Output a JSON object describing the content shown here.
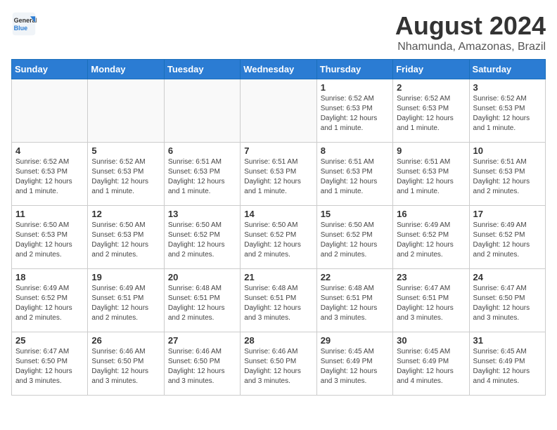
{
  "header": {
    "logo_line1": "General",
    "logo_line2": "Blue",
    "main_title": "August 2024",
    "subtitle": "Nhamunda, Amazonas, Brazil"
  },
  "weekdays": [
    "Sunday",
    "Monday",
    "Tuesday",
    "Wednesday",
    "Thursday",
    "Friday",
    "Saturday"
  ],
  "weeks": [
    [
      {
        "day": "",
        "empty": true
      },
      {
        "day": "",
        "empty": true
      },
      {
        "day": "",
        "empty": true
      },
      {
        "day": "",
        "empty": true
      },
      {
        "day": "1",
        "sunrise": "6:52 AM",
        "sunset": "6:53 PM",
        "daylight": "12 hours and 1 minute."
      },
      {
        "day": "2",
        "sunrise": "6:52 AM",
        "sunset": "6:53 PM",
        "daylight": "12 hours and 1 minute."
      },
      {
        "day": "3",
        "sunrise": "6:52 AM",
        "sunset": "6:53 PM",
        "daylight": "12 hours and 1 minute."
      }
    ],
    [
      {
        "day": "4",
        "sunrise": "6:52 AM",
        "sunset": "6:53 PM",
        "daylight": "12 hours and 1 minute."
      },
      {
        "day": "5",
        "sunrise": "6:52 AM",
        "sunset": "6:53 PM",
        "daylight": "12 hours and 1 minute."
      },
      {
        "day": "6",
        "sunrise": "6:51 AM",
        "sunset": "6:53 PM",
        "daylight": "12 hours and 1 minute."
      },
      {
        "day": "7",
        "sunrise": "6:51 AM",
        "sunset": "6:53 PM",
        "daylight": "12 hours and 1 minute."
      },
      {
        "day": "8",
        "sunrise": "6:51 AM",
        "sunset": "6:53 PM",
        "daylight": "12 hours and 1 minute."
      },
      {
        "day": "9",
        "sunrise": "6:51 AM",
        "sunset": "6:53 PM",
        "daylight": "12 hours and 1 minute."
      },
      {
        "day": "10",
        "sunrise": "6:51 AM",
        "sunset": "6:53 PM",
        "daylight": "12 hours and 2 minutes."
      }
    ],
    [
      {
        "day": "11",
        "sunrise": "6:50 AM",
        "sunset": "6:53 PM",
        "daylight": "12 hours and 2 minutes."
      },
      {
        "day": "12",
        "sunrise": "6:50 AM",
        "sunset": "6:53 PM",
        "daylight": "12 hours and 2 minutes."
      },
      {
        "day": "13",
        "sunrise": "6:50 AM",
        "sunset": "6:52 PM",
        "daylight": "12 hours and 2 minutes."
      },
      {
        "day": "14",
        "sunrise": "6:50 AM",
        "sunset": "6:52 PM",
        "daylight": "12 hours and 2 minutes."
      },
      {
        "day": "15",
        "sunrise": "6:50 AM",
        "sunset": "6:52 PM",
        "daylight": "12 hours and 2 minutes."
      },
      {
        "day": "16",
        "sunrise": "6:49 AM",
        "sunset": "6:52 PM",
        "daylight": "12 hours and 2 minutes."
      },
      {
        "day": "17",
        "sunrise": "6:49 AM",
        "sunset": "6:52 PM",
        "daylight": "12 hours and 2 minutes."
      }
    ],
    [
      {
        "day": "18",
        "sunrise": "6:49 AM",
        "sunset": "6:52 PM",
        "daylight": "12 hours and 2 minutes."
      },
      {
        "day": "19",
        "sunrise": "6:49 AM",
        "sunset": "6:51 PM",
        "daylight": "12 hours and 2 minutes."
      },
      {
        "day": "20",
        "sunrise": "6:48 AM",
        "sunset": "6:51 PM",
        "daylight": "12 hours and 2 minutes."
      },
      {
        "day": "21",
        "sunrise": "6:48 AM",
        "sunset": "6:51 PM",
        "daylight": "12 hours and 3 minutes."
      },
      {
        "day": "22",
        "sunrise": "6:48 AM",
        "sunset": "6:51 PM",
        "daylight": "12 hours and 3 minutes."
      },
      {
        "day": "23",
        "sunrise": "6:47 AM",
        "sunset": "6:51 PM",
        "daylight": "12 hours and 3 minutes."
      },
      {
        "day": "24",
        "sunrise": "6:47 AM",
        "sunset": "6:50 PM",
        "daylight": "12 hours and 3 minutes."
      }
    ],
    [
      {
        "day": "25",
        "sunrise": "6:47 AM",
        "sunset": "6:50 PM",
        "daylight": "12 hours and 3 minutes."
      },
      {
        "day": "26",
        "sunrise": "6:46 AM",
        "sunset": "6:50 PM",
        "daylight": "12 hours and 3 minutes."
      },
      {
        "day": "27",
        "sunrise": "6:46 AM",
        "sunset": "6:50 PM",
        "daylight": "12 hours and 3 minutes."
      },
      {
        "day": "28",
        "sunrise": "6:46 AM",
        "sunset": "6:50 PM",
        "daylight": "12 hours and 3 minutes."
      },
      {
        "day": "29",
        "sunrise": "6:45 AM",
        "sunset": "6:49 PM",
        "daylight": "12 hours and 3 minutes."
      },
      {
        "day": "30",
        "sunrise": "6:45 AM",
        "sunset": "6:49 PM",
        "daylight": "12 hours and 4 minutes."
      },
      {
        "day": "31",
        "sunrise": "6:45 AM",
        "sunset": "6:49 PM",
        "daylight": "12 hours and 4 minutes."
      }
    ]
  ]
}
